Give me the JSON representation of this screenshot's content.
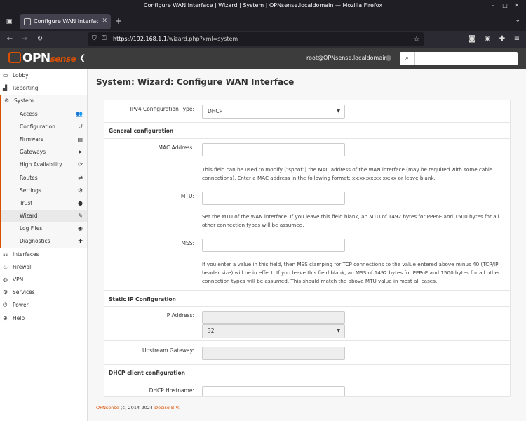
{
  "browser": {
    "window_title": "Configure WAN Interface | Wizard | System | OPNsense.localdomain — Mozilla Firefox",
    "tab_title": "Configure WAN Interface |",
    "url_host": "https://192.168.1.1",
    "url_path": "/wizard.php?xml=system"
  },
  "header": {
    "logo_main": "OPN",
    "logo_sense": "sense",
    "user": "root@OPNsense.localdomain"
  },
  "sidebar": {
    "lobby": "Lobby",
    "reporting": "Reporting",
    "system": "System",
    "system_items": [
      "Access",
      "Configuration",
      "Firmware",
      "Gateways",
      "High Availability",
      "Routes",
      "Settings",
      "Trust",
      "Wizard",
      "Log Files",
      "Diagnostics"
    ],
    "interfaces": "Interfaces",
    "firewall": "Firewall",
    "vpn": "VPN",
    "services": "Services",
    "power": "Power",
    "help": "Help"
  },
  "page": {
    "title": "System: Wizard: Configure WAN Interface",
    "ipv4_type_label": "IPv4 Configuration Type:",
    "ipv4_type_value": "DHCP",
    "general_section": "General configuration",
    "mac_label": "MAC Address:",
    "mac_help": "This field can be used to modify (\"spoof\") the MAC address of the WAN interface (may be required with some cable connections). Enter a MAC address in the following format: xx:xx:xx:xx:xx:xx or leave blank.",
    "mtu_label": "MTU:",
    "mtu_help": "Set the MTU of the WAN interface. If you leave this field blank, an MTU of 1492 bytes for PPPoE and 1500 bytes for all other connection types will be assumed.",
    "mss_label": "MSS:",
    "mss_help": "If you enter a value in this field, then MSS clamping for TCP connections to the value entered above minus 40 (TCP/IP header size) will be in effect. If you leave this field blank, an MSS of 1492 bytes for PPPoE and 1500 bytes for all other connection types will be assumed. This should match the above MTU value in most all cases.",
    "static_section": "Static IP Configuration",
    "ip_label": "IP Address:",
    "subnet_value": "32",
    "gateway_label": "Upstream Gateway:",
    "dhcp_section": "DHCP client configuration",
    "dhcp_hostname_label": "DHCP Hostname:"
  },
  "footer": {
    "brand": "OPNsense",
    "copyright": "(c) 2014-2024",
    "company": "Deciso B.V."
  }
}
